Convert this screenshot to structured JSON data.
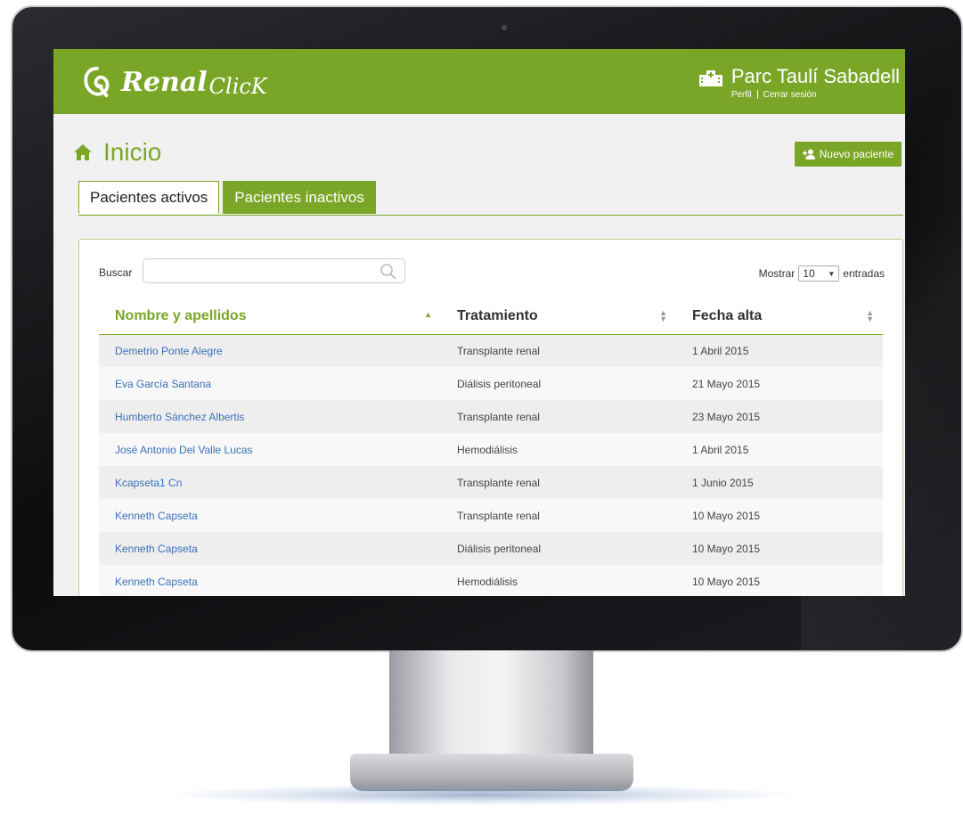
{
  "header": {
    "logo_word": "Renal",
    "logo_word2": "ClicK",
    "org_name": "Parc Taulí Sabadell",
    "profile_link": "Perfil",
    "logout_link": "Cerrar sesión"
  },
  "page": {
    "title": "Inicio",
    "new_patient_label": "Nuevo paciente"
  },
  "tabs": [
    {
      "label": "Pacientes activos",
      "active": true
    },
    {
      "label": "Pacientes inactivos",
      "active": false
    }
  ],
  "table_controls": {
    "search_label": "Buscar",
    "search_value": "",
    "show_label": "Mostrar",
    "page_size": "10",
    "entries_label": "entradas"
  },
  "table": {
    "columns": [
      "Nombre y apellidos",
      "Tratamiento",
      "Fecha alta"
    ],
    "rows": [
      [
        "Demetrio Ponte Alegre",
        "Transplante renal",
        "1 Abril 2015"
      ],
      [
        "Eva García Santana",
        "Diálisis peritoneal",
        "21 Mayo 2015"
      ],
      [
        "Humberto Sánchez Albertis",
        "Transplante renal",
        "23 Mayo 2015"
      ],
      [
        "José Antonio Del Valle Lucas",
        "Hemodiálisis",
        "1 Abril 2015"
      ],
      [
        "Kcapseta1 Cn",
        "Transplante renal",
        "1 Junio 2015"
      ],
      [
        "Kenneth Capseta",
        "Transplante renal",
        "10 Mayo 2015"
      ],
      [
        "Kenneth Capseta",
        "Diálisis peritoneal",
        "10 Mayo 2015"
      ],
      [
        "Kenneth Capseta",
        "Hemodiálisis",
        "10 Mayo 2015"
      ]
    ]
  },
  "colors": {
    "brand": "#7aa628",
    "link": "#3a70b8"
  }
}
